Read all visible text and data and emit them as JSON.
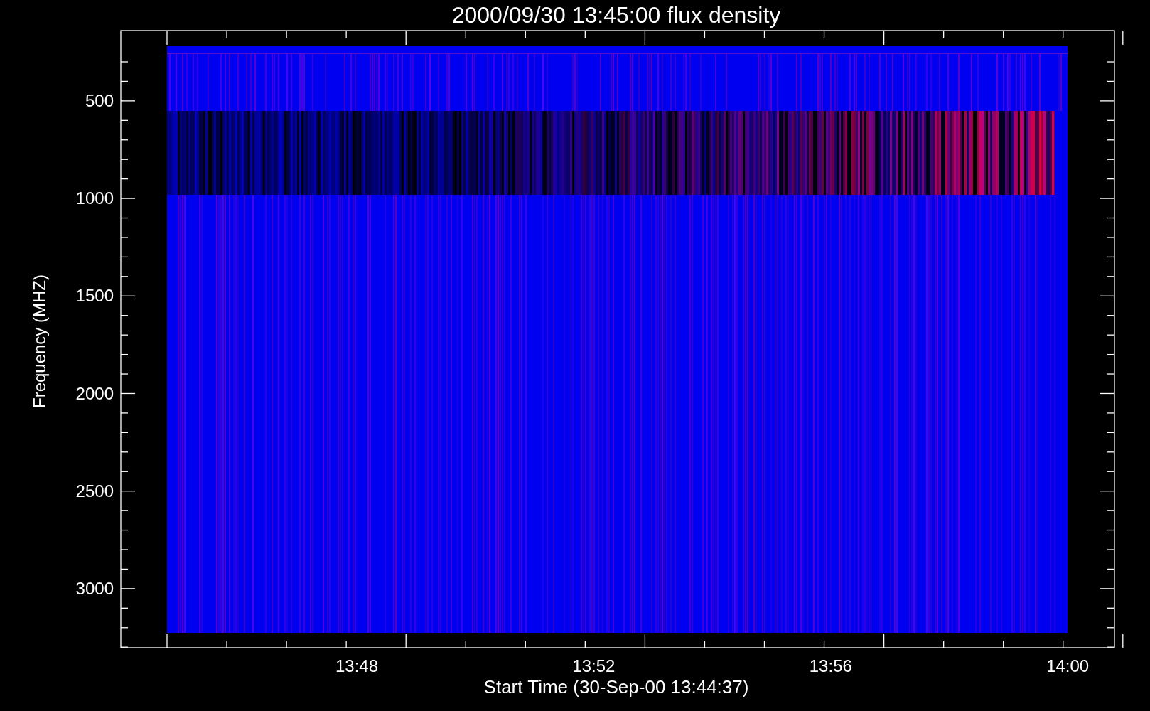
{
  "title": "2000/09/30 13:45:00 flux density",
  "x_axis": {
    "label": "Start Time (30-Sep-00 13:44:37)",
    "ticks": [
      "13:48",
      "13:52",
      "13:56",
      "14:00"
    ]
  },
  "y_axis": {
    "label": "Frequency (MHZ)",
    "ticks": [
      "500",
      "1000",
      "1500",
      "2000",
      "2500",
      "3000"
    ]
  }
}
